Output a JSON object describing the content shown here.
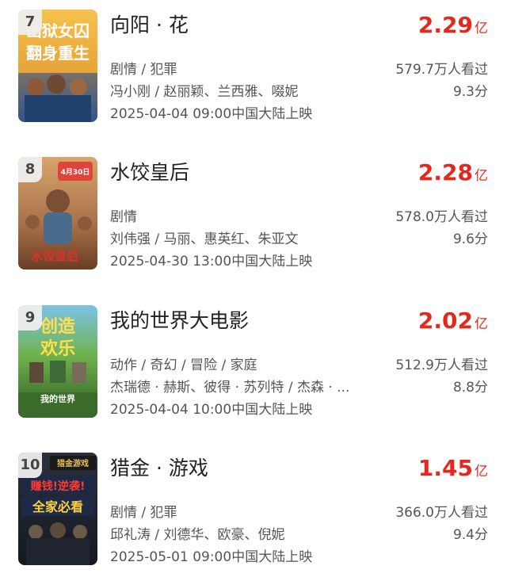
{
  "movies": [
    {
      "rank": "7",
      "title": "向阳 · 花",
      "box_office": "2.29",
      "box_unit": "亿",
      "genre": "剧情 / 犯罪",
      "cast": "冯小刚 / 赵丽颖、兰西雅、啜妮",
      "release": "2025-04-04 09:00中国大陆上映",
      "viewers": "579.7万人看过",
      "rating": "9.3分",
      "poster_text": [
        "出狱女囚",
        "翻身重生"
      ],
      "poster_colors": [
        "#f2b94a",
        "#3f6aa6"
      ]
    },
    {
      "rank": "8",
      "title": "水饺皇后",
      "box_office": "2.28",
      "box_unit": "亿",
      "genre": "剧情",
      "cast": "刘伟强 / 马丽、惠英红、朱亚文",
      "release": "2025-04-30 13:00中国大陆上映",
      "viewers": "578.0万人看过",
      "rating": "9.6分",
      "poster_text": [
        "4月30日",
        "水饺皇后"
      ],
      "poster_colors": [
        "#c98a55",
        "#7a4a2c"
      ]
    },
    {
      "rank": "9",
      "title": "我的世界大电影",
      "box_office": "2.02",
      "box_unit": "亿",
      "genre": "动作 / 奇幻 / 冒险 / 家庭",
      "cast": "杰瑞德 · 赫斯、彼得 · 苏列特 / 杰森 · ...",
      "release": "2025-04-04 10:00中国大陆上映",
      "viewers": "512.9万人看过",
      "rating": "8.8分",
      "poster_text": [
        "创造",
        "欢乐",
        "我的世界"
      ],
      "poster_colors": [
        "#6fb24a",
        "#2e5a25"
      ]
    },
    {
      "rank": "10",
      "title": "猎金 · 游戏",
      "box_office": "1.45",
      "box_unit": "亿",
      "genre": "剧情 / 犯罪",
      "cast": "邱礼涛 / 刘德华、欧豪、倪妮",
      "release": "2025-05-01 09:00中国大陆上映",
      "viewers": "366.0万人看过",
      "rating": "9.4分",
      "poster_text": [
        "猎金游戏",
        "赚钱!逆袭!",
        "全家必看"
      ],
      "poster_colors": [
        "#1d2330",
        "#3b4150"
      ]
    }
  ]
}
